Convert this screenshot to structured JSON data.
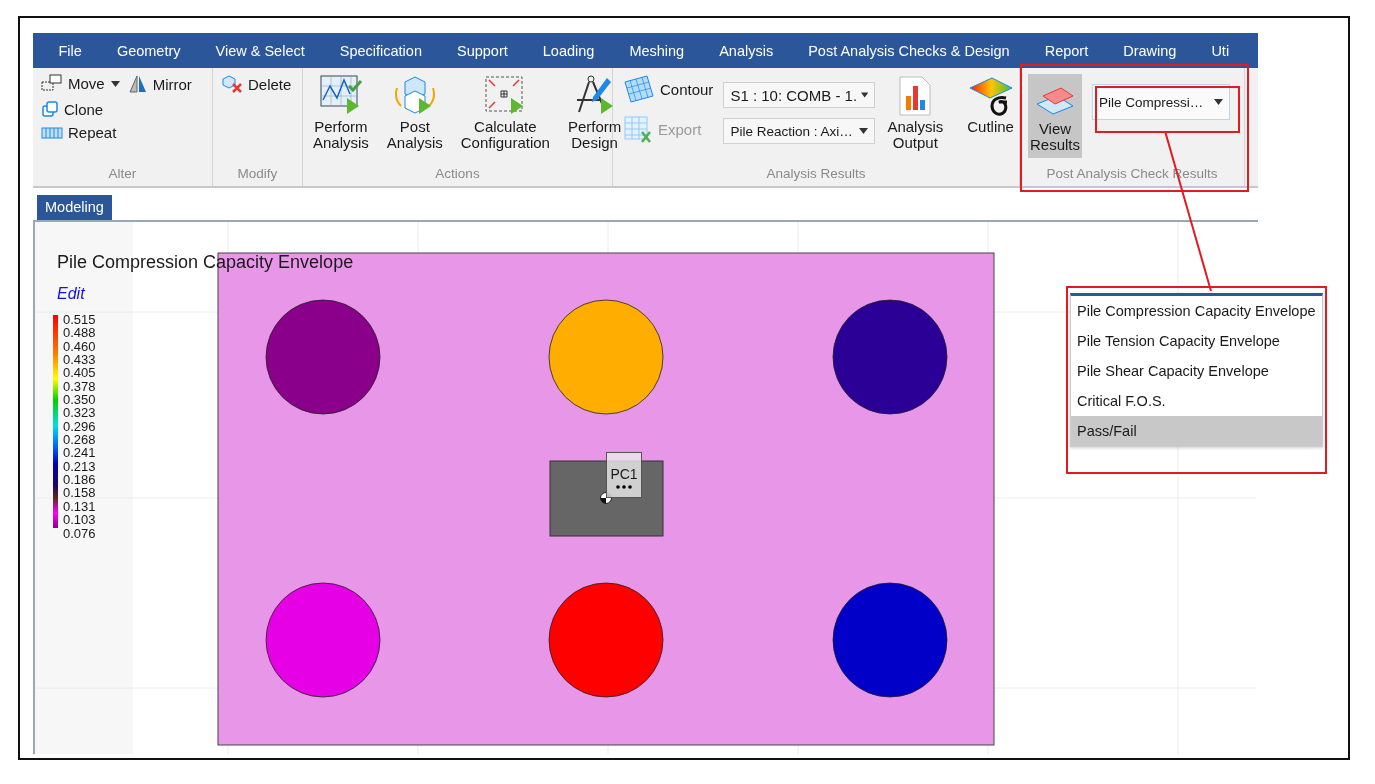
{
  "menu_bar": {
    "items": [
      {
        "label": "File"
      },
      {
        "label": "Geometry"
      },
      {
        "label": "View & Select"
      },
      {
        "label": "Specification"
      },
      {
        "label": "Support"
      },
      {
        "label": "Loading"
      },
      {
        "label": "Meshing"
      },
      {
        "label": "Analysis"
      },
      {
        "label": "Post Analysis Checks & Design"
      },
      {
        "label": "Report"
      },
      {
        "label": "Drawing"
      },
      {
        "label": "Uti"
      }
    ]
  },
  "ribbon": {
    "alter": {
      "label": "Alter",
      "move": "Move",
      "mirror": "Mirror",
      "clone": "Clone",
      "repeat": "Repeat"
    },
    "modify": {
      "label": "Modify",
      "delete": "Delete"
    },
    "actions": {
      "label": "Actions",
      "buttons": [
        {
          "label": "Perform Analysis",
          "kind": "analysis"
        },
        {
          "label": "Post Analysis",
          "kind": "post"
        },
        {
          "label": "Calculate Configuration",
          "kind": "configuration"
        },
        {
          "label": "Perform Design",
          "kind": "design"
        }
      ]
    },
    "analysis_results": {
      "label": "Analysis Results",
      "contour": "Contour",
      "export": {
        "label": "Export",
        "disabled": true
      },
      "load_combo": "S1 : 10: COMB - 1.",
      "result_combo": "Pile Reaction : Axi…",
      "output": "Analysis Output",
      "cutline": "Cutline"
    },
    "post_check": {
      "label": "Post Analysis Check Results",
      "view_results": {
        "label": "View Results",
        "selected": true
      },
      "result_combo": "Pile Compressi…"
    }
  },
  "document_tabs": [
    {
      "label": "Modeling",
      "selected": true
    }
  ],
  "canvas": {
    "title": "Pile Compression Capacity Envelope",
    "edit_link": "Edit",
    "legend": [
      "0.515",
      "0.488",
      "0.460",
      "0.433",
      "0.405",
      "0.378",
      "0.350",
      "0.323",
      "0.296",
      "0.268",
      "0.241",
      "0.213",
      "0.186",
      "0.158",
      "0.131",
      "0.103",
      "0.076"
    ],
    "piles": [
      {
        "color": "#8b008b"
      },
      {
        "color": "#ffad00"
      },
      {
        "color": "#2a0096"
      },
      {
        "color": "#e600e6"
      },
      {
        "color": "#ff0000"
      },
      {
        "color": "#0000c8"
      }
    ],
    "pier_label": "PC1"
  },
  "dropdown": {
    "items": [
      {
        "label": "Pile Compression Capacity Envelope",
        "selected": false
      },
      {
        "label": "Pile Tension Capacity Envelope",
        "selected": false
      },
      {
        "label": "Pile Shear Capacity Envelope",
        "selected": false
      },
      {
        "label": "Critical F.O.S.",
        "selected": false
      },
      {
        "label": "Pass/Fail",
        "selected": true
      }
    ]
  }
}
